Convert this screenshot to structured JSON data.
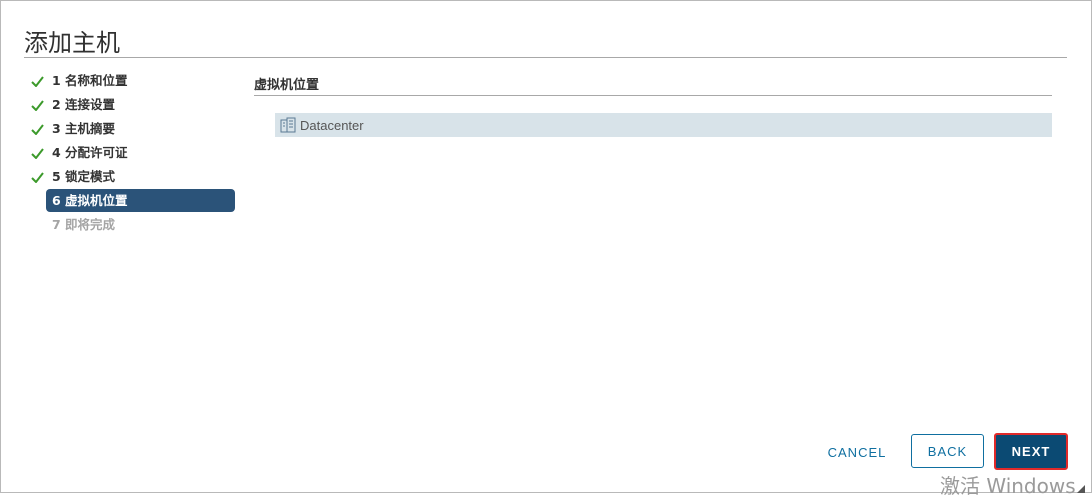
{
  "dialog": {
    "title": "添加主机"
  },
  "steps": [
    {
      "label": "1 名称和位置",
      "state": "done"
    },
    {
      "label": "2 连接设置",
      "state": "done"
    },
    {
      "label": "3 主机摘要",
      "state": "done"
    },
    {
      "label": "4 分配许可证",
      "state": "done"
    },
    {
      "label": "5 锁定模式",
      "state": "done"
    },
    {
      "label": "6 虚拟机位置",
      "state": "active"
    },
    {
      "label": "7 即将完成",
      "state": "disabled"
    }
  ],
  "content": {
    "section_title": "虚拟机位置",
    "tree": {
      "node_label": "Datacenter",
      "node_icon": "datacenter-icon"
    }
  },
  "buttons": {
    "cancel": "CANCEL",
    "back": "BACK",
    "next": "NEXT"
  },
  "watermark": "激活 Windows",
  "colors": {
    "accent": "#0f6fa0",
    "active_step_bg": "#2b5379",
    "next_bg": "#0b4a73",
    "highlight_border": "#e12a2a",
    "check_green": "#3c9a2b",
    "selected_row_bg": "#d8e3e9"
  }
}
